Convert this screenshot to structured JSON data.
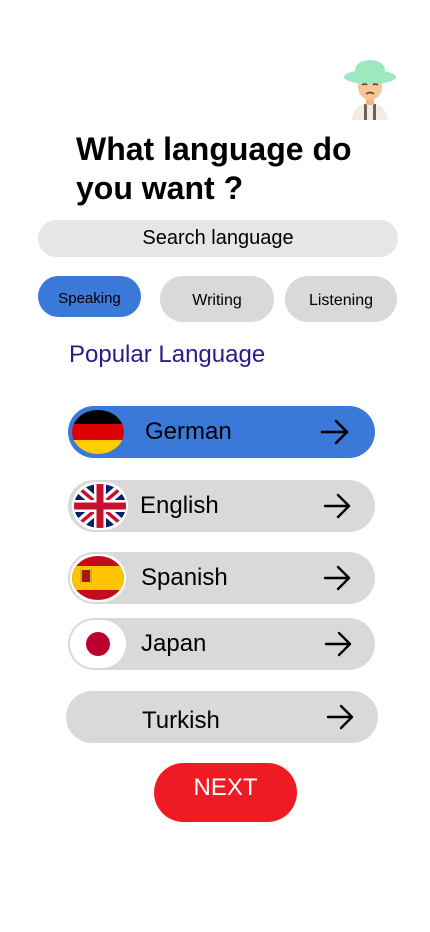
{
  "header": {
    "title": "What language do you want ?"
  },
  "search": {
    "placeholder": "Search language"
  },
  "tabs": [
    {
      "label": "Speaking",
      "active": true
    },
    {
      "label": "Writing",
      "active": false
    },
    {
      "label": "Listening",
      "active": false
    }
  ],
  "section": {
    "title": "Popular Language"
  },
  "languages": [
    {
      "label": "German",
      "flag": "germany-flag-icon",
      "selected": true
    },
    {
      "label": "English",
      "flag": "uk-flag-icon",
      "selected": false
    },
    {
      "label": "Spanish",
      "flag": "spain-flag-icon",
      "selected": false
    },
    {
      "label": "Japan",
      "flag": "japan-flag-icon",
      "selected": false
    },
    {
      "label": "Turkish",
      "flag": null,
      "selected": false
    }
  ],
  "next_button": {
    "label": "NEXT"
  },
  "colors": {
    "accent": "#3b79d8",
    "pill": "#d9d9d9",
    "search_bg": "#e6e6e6",
    "next": "#ee1b24",
    "section_title": "#2a1a8a"
  }
}
